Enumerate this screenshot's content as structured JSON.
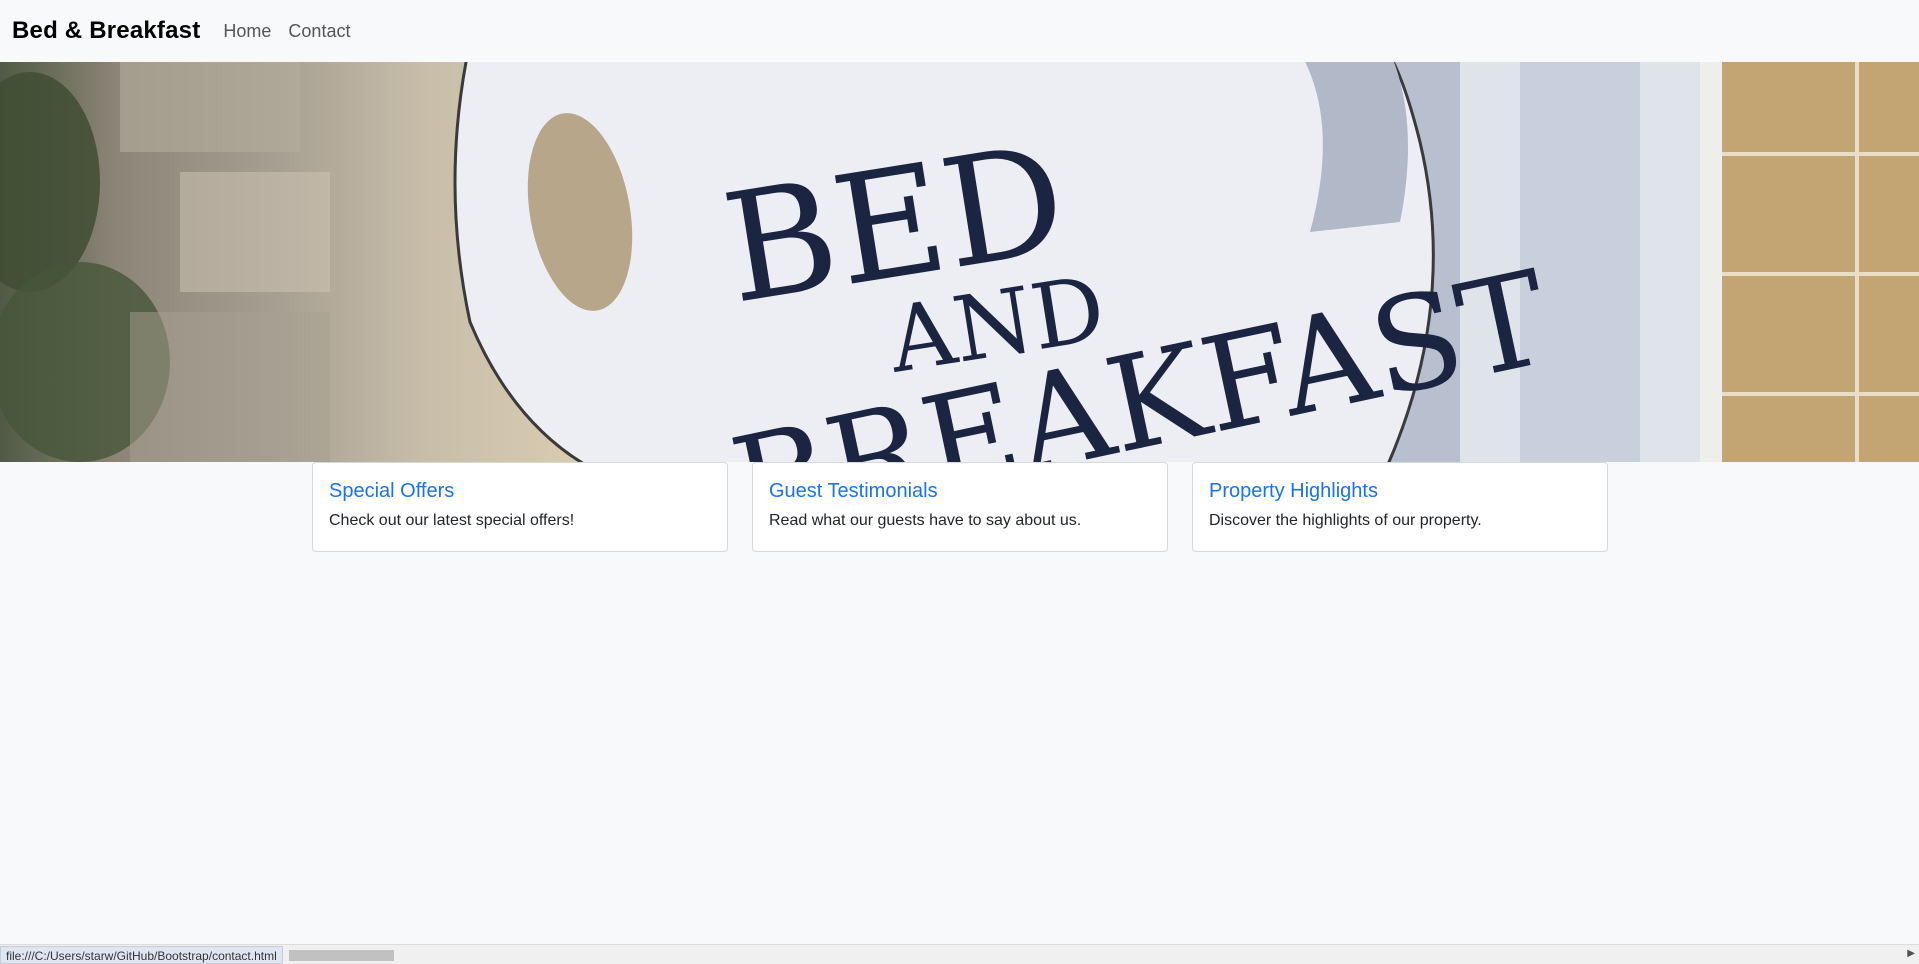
{
  "navbar": {
    "brand": "Bed & Breakfast",
    "links": [
      "Home",
      "Contact"
    ]
  },
  "hero": {
    "sign_lines": [
      "BED",
      "AND",
      "BREAKFAST"
    ]
  },
  "cards": [
    {
      "title": "Special Offers",
      "text": "Check out our latest special offers!"
    },
    {
      "title": "Guest Testimonials",
      "text": "Read what our guests have to say about us."
    },
    {
      "title": "Property Highlights",
      "text": "Discover the highlights of our property."
    }
  ],
  "statusbar": {
    "url": "file:///C:/Users/starw/GitHub/Bootstrap/contact.html"
  },
  "colors": {
    "link": "#1a73e8",
    "page_bg": "#f8f9fa",
    "sign_text": "#1b2440"
  }
}
